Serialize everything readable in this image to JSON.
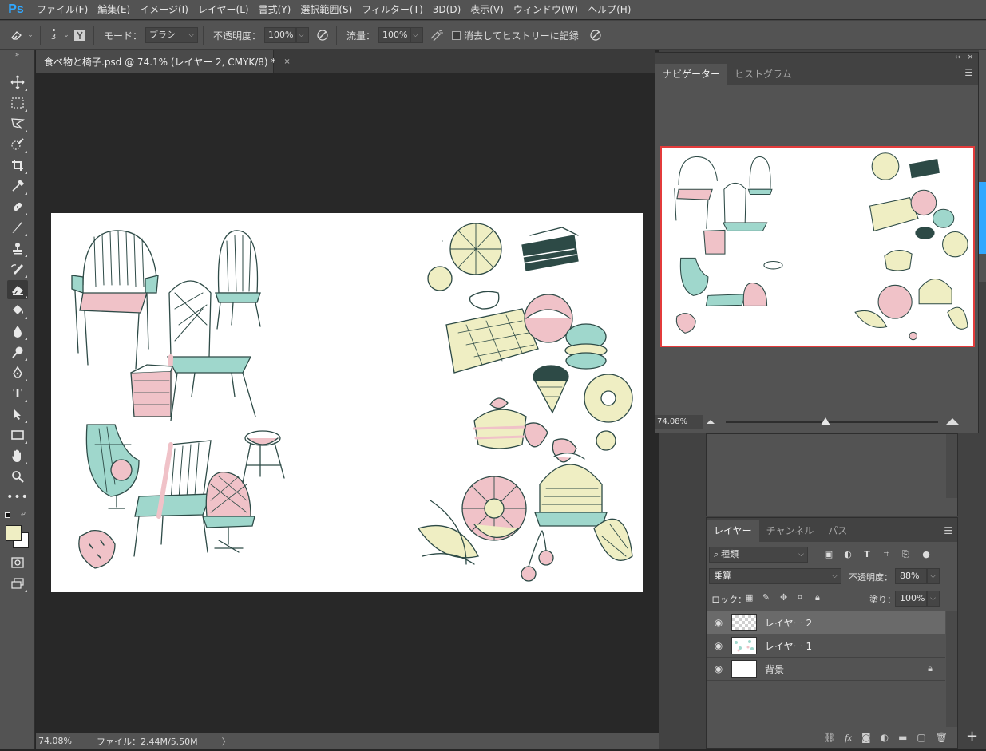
{
  "app": {
    "logo": "Ps"
  },
  "menu": [
    "ファイル(F)",
    "編集(E)",
    "イメージ(I)",
    "レイヤー(L)",
    "書式(Y)",
    "選択範囲(S)",
    "フィルター(T)",
    "3D(D)",
    "表示(V)",
    "ウィンドウ(W)",
    "ヘルプ(H)"
  ],
  "options": {
    "brush_size": "3",
    "mode_label": "モード：",
    "mode_value": "ブラシ",
    "opacity_label": "不透明度：",
    "opacity_value": "100%",
    "flow_label": "流量：",
    "flow_value": "100%",
    "erase_history_label": "消去してヒストリーに記録"
  },
  "document": {
    "tab_title": "食べ物と椅子.psd @ 74.1% (レイヤー 2, CMYK/8) *",
    "close": "×"
  },
  "status": {
    "zoom": "74.08%",
    "file": "ファイル：2.44M/5.50M",
    "arrow": "〉"
  },
  "navigator": {
    "tabs": [
      "ナビゲーター",
      "ヒストグラム"
    ],
    "zoom": "74.08%",
    "collapse": "‹‹",
    "close": "×"
  },
  "layers_panel": {
    "tabs": [
      "レイヤー",
      "チャンネル",
      "パス"
    ],
    "filter_kind": "種類",
    "blend_mode": "乗算",
    "opacity_label": "不透明度：",
    "opacity_value": "88%",
    "lock_label": "ロック：",
    "fill_label": "塗り：",
    "fill_value": "100%",
    "layers": [
      {
        "name": "レイヤー 2",
        "selected": true
      },
      {
        "name": "レイヤー 1",
        "selected": false
      },
      {
        "name": "背景",
        "selected": false,
        "locked": true
      }
    ]
  },
  "colors": {
    "foreground": "#efeec3",
    "background": "#ffffff",
    "accent": "#31a8ff",
    "nav_frame": "#e33b3b",
    "mint": "#9fd7cc",
    "pink": "#f0c2c8",
    "ink": "#2d4a46"
  }
}
